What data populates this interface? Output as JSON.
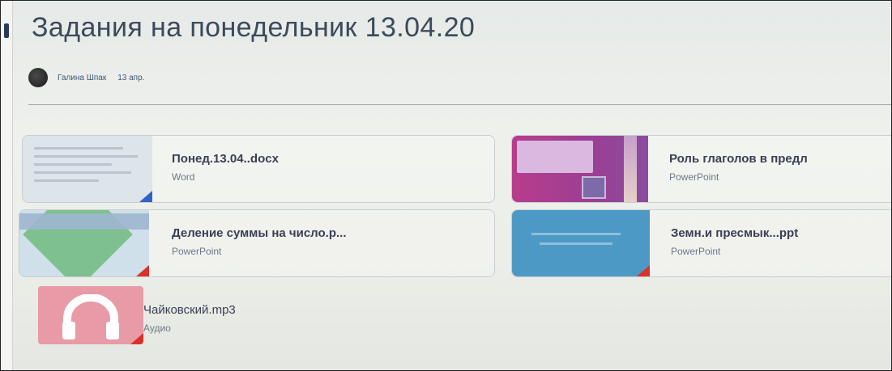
{
  "post": {
    "title": "Задания на понедельник 13.04.20",
    "author": "Галина Шпак",
    "date": "13 апр."
  },
  "attachments": [
    {
      "name": "Понед.13.04..docx",
      "type": "Word",
      "icon": "word-doc-thumbnail"
    },
    {
      "name": "Роль глаголов в предл",
      "type": "PowerPoint",
      "icon": "powerpoint-thumbnail"
    },
    {
      "name": "Деление суммы на число.p...",
      "type": "PowerPoint",
      "icon": "powerpoint-thumbnail"
    },
    {
      "name": "Земн.и пресмык...ppt",
      "type": "PowerPoint",
      "icon": "powerpoint-thumbnail"
    },
    {
      "name": "Чайковский.mp3",
      "type": "Аудио",
      "icon": "headphones-icon"
    }
  ]
}
